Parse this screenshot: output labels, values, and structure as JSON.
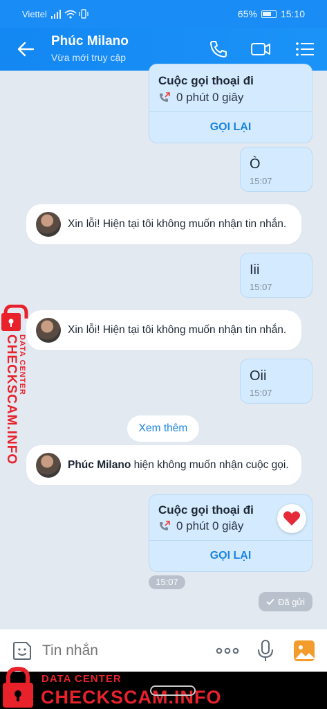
{
  "status_bar": {
    "carrier": "Viettel",
    "battery": "65%",
    "time": "15:10"
  },
  "header": {
    "name": "Phúc Milano",
    "subtitle": "Vừa mới truy cập"
  },
  "messages": {
    "call1": {
      "title": "Cuộc gọi thoại đi",
      "duration": "0 phút 0 giây",
      "action": "GỌI LẠI"
    },
    "out1": {
      "text": "Ò",
      "time": "15:07"
    },
    "in1": {
      "text": "Xin lỗi! Hiện tại tôi không muốn nhận tin nhắn."
    },
    "out2": {
      "text": "Iii",
      "time": "15:07"
    },
    "in2": {
      "text": "Xin lỗi! Hiện tại tôi không muốn nhận tin nhắn."
    },
    "out3": {
      "text": "Oii",
      "time": "15:07"
    },
    "see_more": "Xem thêm",
    "in3": {
      "name": "Phúc Milano",
      "text": " hiện không muốn nhận cuộc gọi."
    },
    "call2": {
      "title": "Cuộc gọi thoại đi",
      "duration": "0 phút 0 giây",
      "action": "GỌI LẠI"
    },
    "time_label": "15:07",
    "sent_status": "Đã gửi"
  },
  "input": {
    "placeholder": "Tin nhắn"
  },
  "watermark": {
    "label_small": "DATA CENTER",
    "label_big": "CHECKSCAM.INFO"
  },
  "colors": {
    "header": "#1a8cf5",
    "accent": "#1a84e0",
    "watermark": "#e8212b"
  }
}
